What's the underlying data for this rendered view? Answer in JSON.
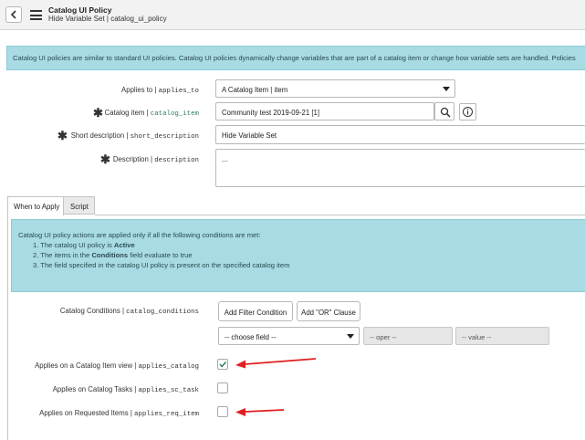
{
  "header": {
    "title": "Catalog UI Policy",
    "subtitle": "Hide Variable Set | catalog_ui_policy"
  },
  "info_banner": "Catalog UI policies are similar to standard UI policies. Catalog UI policies dynamically change variables that are part of a catalog item or change how variable sets are handled. Policies",
  "form": {
    "applies_to": {
      "label": "Applies to | ",
      "field": "applies_to",
      "value": "A Catalog Item | item"
    },
    "catalog_item": {
      "label": "Catalog item | ",
      "field": "catalog_item",
      "value": "Community test 2019-09-21 [1]"
    },
    "short_description": {
      "label": "Short description | ",
      "field": "short_description",
      "value": "Hide Variable Set"
    },
    "description": {
      "label": "Description | ",
      "field": "description",
      "value": "..."
    }
  },
  "tabs": [
    {
      "label": "When to Apply",
      "active": true
    },
    {
      "label": "Script",
      "active": false
    }
  ],
  "conditions_info": {
    "intro": "Catalog UI policy actions are applied only if all the following conditions are met:",
    "line1_pre": "1. The catalog UI policy is ",
    "line1_bold": "Active",
    "line2_pre": "2. The items in the ",
    "line2_bold": "Conditions",
    "line2_post": " field evaluate to true",
    "line3": "3. The field specified in the catalog UI policy is present on the specified catalog item"
  },
  "catalog_conditions": {
    "label": "Catalog Conditions | ",
    "field": "catalog_conditions",
    "add_filter_button": "Add Filter Condition",
    "add_or_button": "Add \"OR\" Clause",
    "choose_field": "-- choose field --",
    "oper": "-- oper --",
    "value": "-- value --"
  },
  "checkboxes": [
    {
      "label": "Applies on a Catalog Item view | ",
      "field": "applies_catalog",
      "checked": true
    },
    {
      "label": "Applies on Catalog Tasks | ",
      "field": "applies_sc_task",
      "checked": false
    },
    {
      "label": "Applies on Requested Items | ",
      "field": "applies_req_item",
      "checked": false
    }
  ],
  "colors": {
    "info_banner_bg": "#a8dbe3",
    "annotation_arrow": "#e02020",
    "field_name_green": "#2e7d5b"
  },
  "icons": [
    "chevron-left-icon",
    "hamburger-menu-icon",
    "dropdown-caret-icon",
    "search-icon",
    "info-icon",
    "required-star-icon",
    "checkmark-icon",
    "red-arrow-annotation"
  ]
}
